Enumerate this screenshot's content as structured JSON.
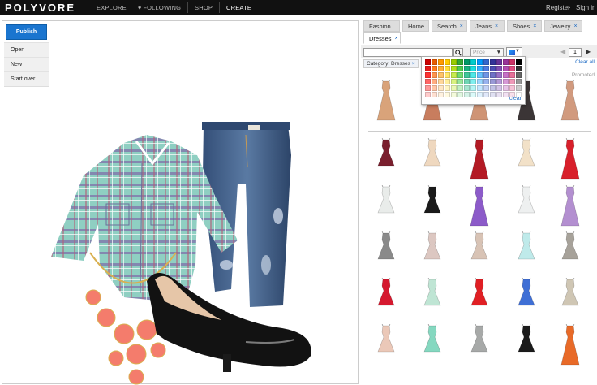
{
  "topnav": {
    "logo": "POLYVORE",
    "links": [
      "EXPLORE",
      "FOLLOWING",
      "SHOP",
      "CREATE"
    ],
    "register": "Register",
    "auth_sep": " · ",
    "signin": "Sign in"
  },
  "editor": {
    "publish_label": "Publish",
    "menu": [
      "Open",
      "New",
      "Start over"
    ]
  },
  "tabs": [
    {
      "label": "Fashion",
      "closable": false
    },
    {
      "label": "Home",
      "closable": false
    },
    {
      "label": "Search",
      "closable": true
    },
    {
      "label": "Jeans",
      "closable": true
    },
    {
      "label": "Shoes",
      "closable": true
    },
    {
      "label": "Jewelry",
      "closable": true
    },
    {
      "label": "Dresses",
      "closable": true
    }
  ],
  "close_glyph": "×",
  "toolbar": {
    "search_value": "",
    "price_placeholder": "Price",
    "page_value": "1"
  },
  "filter": {
    "chip_label": "Category: Dresses",
    "clear_all": "Clear all"
  },
  "promoted_label": "Promoted",
  "colorpicker": {
    "clear_label": "clear",
    "swatches": [
      "#cc0000",
      "#e65c00",
      "#ff9900",
      "#ffcc00",
      "#99cc00",
      "#33aa33",
      "#009966",
      "#00cccc",
      "#0099ff",
      "#3366cc",
      "#333399",
      "#663399",
      "#993399",
      "#cc3366",
      "#000000",
      "#e61919",
      "#ff7a1a",
      "#ffad33",
      "#ffdd33",
      "#b3e01a",
      "#4dcc4d",
      "#19b380",
      "#1ae0e0",
      "#33adff",
      "#4d7ae0",
      "#4d4db3",
      "#7f4db3",
      "#b34db3",
      "#e04d80",
      "#333333",
      "#ff3333",
      "#ff944d",
      "#ffc266",
      "#ffe666",
      "#c6ec4d",
      "#70db70",
      "#40c799",
      "#4de8e8",
      "#66c2ff",
      "#7096e6",
      "#7070c7",
      "#9970c7",
      "#c770c7",
      "#e67099",
      "#666666",
      "#ff6666",
      "#ffad80",
      "#ffd699",
      "#ffee99",
      "#d9f280",
      "#99e699",
      "#70d6b3",
      "#80efef",
      "#99d6ff",
      "#99b3ef",
      "#9999d6",
      "#b399d6",
      "#d699d6",
      "#ef99b8",
      "#999999",
      "#ff9999",
      "#ffc6a6",
      "#ffe6c2",
      "#fff5c2",
      "#e9f8b3",
      "#c2f0c2",
      "#a6e6cf",
      "#b3f5f5",
      "#c2e6ff",
      "#c2d1f5",
      "#c2c2e6",
      "#d1c2e6",
      "#e6c2e6",
      "#f5c2d6",
      "#cccccc",
      "#ffcccc",
      "#ffe0d1",
      "#fff2e0",
      "#fffae0",
      "#f4fbdb",
      "#e0f7e0",
      "#d4f2e7",
      "#dbfafa",
      "#e0f2ff",
      "#e0e8fa",
      "#e0e0f2",
      "#e8e0f2",
      "#f2e0f2",
      "#fae0eb",
      "#ffffff"
    ]
  },
  "results": {
    "promoted_colors": [
      "#d9a37a",
      "#c87d5e",
      "#cf9475",
      "#3b3536",
      "#d19a7e"
    ],
    "grid_colors": [
      [
        "#7a1f2e",
        "#efd8bf",
        "#b31a24",
        "#f2e1c8",
        "#d8202b"
      ],
      [
        "#e9ecea",
        "#1a1a1a",
        "#8c5bc9",
        "#eef0f0",
        "#b38fd0"
      ],
      [
        "#8a8a8a",
        "#dcc7c1",
        "#d8c3b5",
        "#bfeaea",
        "#a7a29a"
      ],
      [
        "#d5192f",
        "#bfe5d4",
        "#e01f24",
        "#3f6fd5",
        "#cfc6b4"
      ],
      [
        "#ebc8b8",
        "#85d8c0",
        "#a7a9a8",
        "#1b1b1b",
        "#e86a28"
      ]
    ]
  }
}
